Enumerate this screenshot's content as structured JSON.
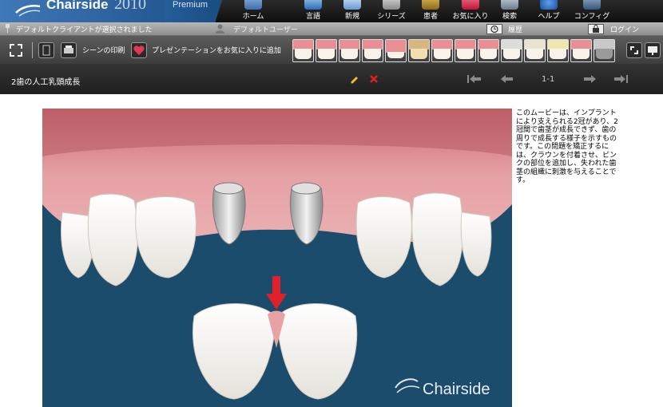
{
  "app": {
    "brand": "Chairside",
    "year": "2010",
    "edition": "Premium"
  },
  "nav": [
    {
      "label": "ホーム",
      "icon": "home-icon"
    },
    {
      "label": "言語",
      "icon": "language-icon"
    },
    {
      "label": "新規",
      "icon": "new-icon"
    },
    {
      "label": "シリーズ",
      "icon": "series-icon"
    },
    {
      "label": "患者",
      "icon": "patient-icon"
    },
    {
      "label": "お気に入り",
      "icon": "favorites-icon"
    },
    {
      "label": "検索",
      "icon": "search-icon"
    },
    {
      "label": "ヘルプ",
      "icon": "help-icon"
    },
    {
      "label": "コンフィグ",
      "icon": "config-icon"
    }
  ],
  "status": {
    "client": "デフォルトクライアントが選択されました",
    "user": "デフォルトユーザー",
    "history": "履歴",
    "login": "ログイン"
  },
  "toolbar": {
    "print_label": "シーンの印刷",
    "favorite_label": "プレゼンテーションをお気に入りに追加"
  },
  "scene": {
    "title": "2歯の人工乳頭成長",
    "page": "1-1",
    "watermark": "Chairside",
    "description": "このムービーは、インプラントにより支えられる2冠があり、2冠間で歯茎が成長できず、歯の周りで成長する様子を示すものです。この問題を矯正するには、クラウンを付着させ、ピンクの部位を追加し、失われた歯茎の組織に刺激を与えることです。"
  },
  "colors": {
    "accent_blue": "#2a62a3",
    "arrow_red": "#e0202a",
    "gum_pink": "#e8a2a6",
    "bg_blue": "#1c4c6b"
  }
}
